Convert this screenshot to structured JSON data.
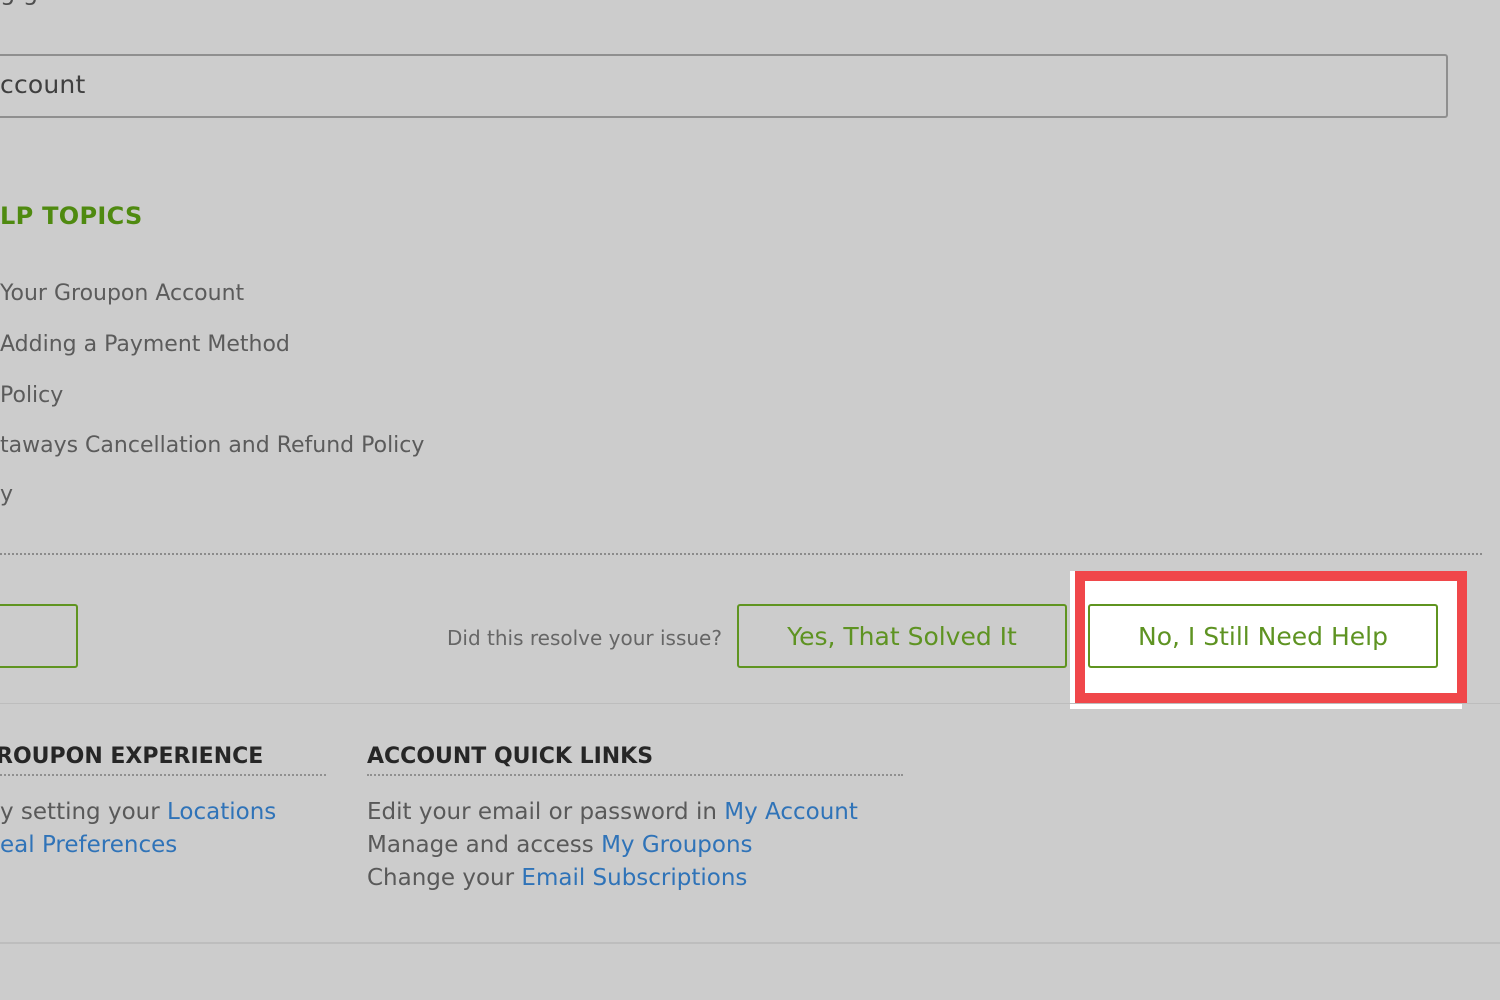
{
  "search": {
    "partial_top_text": "g g",
    "value": "ccount"
  },
  "help_topics": {
    "title": "LP TOPICS",
    "items": [
      "Your Groupon Account",
      "Adding a Payment Method",
      "Policy",
      "taways Cancellation and Refund Policy",
      "y"
    ]
  },
  "feedback": {
    "question": "Did this resolve your issue?",
    "yes_label": "Yes, That Solved It",
    "no_label": "No, I Still Need Help"
  },
  "footer": {
    "experience": {
      "heading": "ROUPON EXPERIENCE",
      "line1_prefix": "y setting your ",
      "line1_link": "Locations",
      "line2_link": "eal Preferences"
    },
    "quick_links": {
      "heading": "ACCOUNT QUICK LINKS",
      "line1_prefix": "Edit your email or password in ",
      "line1_link": "My Account",
      "line2_prefix": "Manage and access ",
      "line2_link": "My Groupons",
      "line3_prefix": "Change your ",
      "line3_link": "Email Subscriptions"
    }
  },
  "colors": {
    "accent_green": "#5e9322",
    "link_blue": "#2f73b8",
    "highlight_red": "#f0474a",
    "page_gray": "#cccccc"
  }
}
